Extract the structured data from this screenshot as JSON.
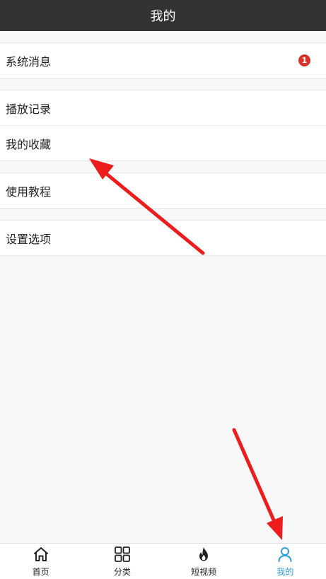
{
  "header": {
    "title": "我的"
  },
  "menu": {
    "messages": {
      "label": "系统消息",
      "badge": "1"
    },
    "history": {
      "label": "播放记录"
    },
    "favorites": {
      "label": "我的收藏"
    },
    "tutorial": {
      "label": "使用教程"
    },
    "settings": {
      "label": "设置选项"
    }
  },
  "tabbar": {
    "items": [
      {
        "label": "首页",
        "icon": "home-icon"
      },
      {
        "label": "分类",
        "icon": "grid-icon"
      },
      {
        "label": "短视频",
        "icon": "flame-icon"
      },
      {
        "label": "我的",
        "icon": "user-icon"
      }
    ],
    "active": "我的"
  },
  "colors": {
    "header_bg": "#333333",
    "badge": "#d6342a",
    "active_tab": "#2c9ed8",
    "annotation_arrow": "#ee1c1c"
  }
}
